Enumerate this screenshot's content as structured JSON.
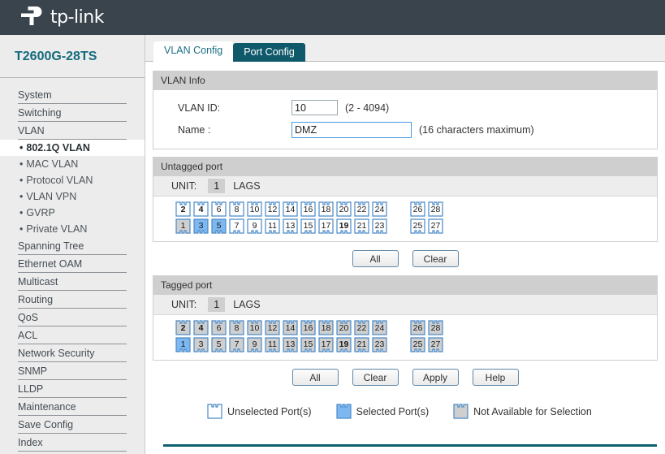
{
  "brand": {
    "name": "tp-link",
    "logo_icon": "tp-link-logo-icon"
  },
  "sidebar": {
    "model": "T2600G-28TS",
    "items": [
      {
        "label": "System",
        "type": "top"
      },
      {
        "label": "Switching",
        "type": "top"
      },
      {
        "label": "VLAN",
        "type": "top"
      },
      {
        "label": "802.1Q VLAN",
        "type": "sub",
        "active": true
      },
      {
        "label": "MAC VLAN",
        "type": "sub"
      },
      {
        "label": "Protocol VLAN",
        "type": "sub"
      },
      {
        "label": "VLAN VPN",
        "type": "sub"
      },
      {
        "label": "GVRP",
        "type": "sub"
      },
      {
        "label": "Private VLAN",
        "type": "sub"
      },
      {
        "label": "Spanning Tree",
        "type": "top"
      },
      {
        "label": "Ethernet OAM",
        "type": "top"
      },
      {
        "label": "Multicast",
        "type": "top"
      },
      {
        "label": "Routing",
        "type": "top"
      },
      {
        "label": "QoS",
        "type": "top"
      },
      {
        "label": "ACL",
        "type": "top"
      },
      {
        "label": "Network Security",
        "type": "top"
      },
      {
        "label": "SNMP",
        "type": "top"
      },
      {
        "label": "LLDP",
        "type": "top"
      },
      {
        "label": "Maintenance",
        "type": "top"
      },
      {
        "label": "Save Config",
        "type": "top"
      },
      {
        "label": "Index",
        "type": "top"
      }
    ],
    "bullet": "•"
  },
  "tabs": [
    {
      "label": "VLAN Config",
      "active": true
    },
    {
      "label": "Port Config",
      "active": false
    }
  ],
  "vlan_info": {
    "section_title": "VLAN Info",
    "vlan_id_label": "VLAN ID:",
    "vlan_id_value": "10",
    "vlan_id_hint": "(2 - 4094)",
    "name_label": "Name :",
    "name_value": "DMZ",
    "name_placeholder": "",
    "name_hint": "(16 characters maximum)"
  },
  "untagged": {
    "section_title": "Untagged port",
    "unit_label": "UNIT:",
    "unit_value": "1",
    "lags_label": "LAGS",
    "top_row": [
      {
        "n": "2",
        "state": "unselected",
        "bold": true
      },
      {
        "n": "4",
        "state": "unselected",
        "bold": true
      },
      {
        "n": "6",
        "state": "unselected",
        "bold": false
      },
      {
        "n": "8",
        "state": "unselected",
        "bold": false
      },
      {
        "n": "10",
        "state": "unselected",
        "bold": false
      },
      {
        "n": "12",
        "state": "unselected",
        "bold": false
      },
      {
        "n": "14",
        "state": "unselected",
        "bold": false
      },
      {
        "n": "16",
        "state": "unselected",
        "bold": false
      },
      {
        "n": "18",
        "state": "unselected",
        "bold": false
      },
      {
        "n": "20",
        "state": "unselected",
        "bold": false
      },
      {
        "n": "22",
        "state": "unselected",
        "bold": false
      },
      {
        "n": "24",
        "state": "unselected",
        "bold": false
      },
      {
        "gap": true
      },
      {
        "n": "26",
        "state": "unselected",
        "bold": false
      },
      {
        "n": "28",
        "state": "unselected",
        "bold": false
      }
    ],
    "bottom_row": [
      {
        "n": "1",
        "state": "unavailable",
        "bold": false
      },
      {
        "n": "3",
        "state": "selected",
        "bold": false
      },
      {
        "n": "5",
        "state": "selected",
        "bold": false
      },
      {
        "n": "7",
        "state": "unselected",
        "bold": false
      },
      {
        "n": "9",
        "state": "unselected",
        "bold": false
      },
      {
        "n": "11",
        "state": "unselected",
        "bold": false
      },
      {
        "n": "13",
        "state": "unselected",
        "bold": false
      },
      {
        "n": "15",
        "state": "unselected",
        "bold": false
      },
      {
        "n": "17",
        "state": "unselected",
        "bold": false
      },
      {
        "n": "19",
        "state": "unselected",
        "bold": true
      },
      {
        "n": "21",
        "state": "unselected",
        "bold": false
      },
      {
        "n": "23",
        "state": "unselected",
        "bold": false
      },
      {
        "gap": true
      },
      {
        "n": "25",
        "state": "unselected",
        "bold": false
      },
      {
        "n": "27",
        "state": "unselected",
        "bold": false
      }
    ],
    "buttons": [
      {
        "label": "All"
      },
      {
        "label": "Clear"
      }
    ]
  },
  "tagged": {
    "section_title": "Tagged port",
    "unit_label": "UNIT:",
    "unit_value": "1",
    "lags_label": "LAGS",
    "top_row": [
      {
        "n": "2",
        "state": "unavailable",
        "bold": true
      },
      {
        "n": "4",
        "state": "unavailable",
        "bold": true
      },
      {
        "n": "6",
        "state": "unavailable",
        "bold": false
      },
      {
        "n": "8",
        "state": "unavailable",
        "bold": false
      },
      {
        "n": "10",
        "state": "unavailable",
        "bold": false
      },
      {
        "n": "12",
        "state": "unavailable",
        "bold": false
      },
      {
        "n": "14",
        "state": "unavailable",
        "bold": false
      },
      {
        "n": "16",
        "state": "unavailable",
        "bold": false
      },
      {
        "n": "18",
        "state": "unavailable",
        "bold": false
      },
      {
        "n": "20",
        "state": "unavailable",
        "bold": false
      },
      {
        "n": "22",
        "state": "unavailable",
        "bold": false
      },
      {
        "n": "24",
        "state": "unavailable",
        "bold": false
      },
      {
        "gap": true
      },
      {
        "n": "26",
        "state": "unavailable",
        "bold": false
      },
      {
        "n": "28",
        "state": "unavailable",
        "bold": false
      }
    ],
    "bottom_row": [
      {
        "n": "1",
        "state": "selected",
        "bold": false
      },
      {
        "n": "3",
        "state": "unavailable",
        "bold": false
      },
      {
        "n": "5",
        "state": "unavailable",
        "bold": false
      },
      {
        "n": "7",
        "state": "unavailable",
        "bold": false
      },
      {
        "n": "9",
        "state": "unavailable",
        "bold": false
      },
      {
        "n": "11",
        "state": "unavailable",
        "bold": false
      },
      {
        "n": "13",
        "state": "unavailable",
        "bold": false
      },
      {
        "n": "15",
        "state": "unavailable",
        "bold": false
      },
      {
        "n": "17",
        "state": "unavailable",
        "bold": false
      },
      {
        "n": "19",
        "state": "unavailable",
        "bold": true
      },
      {
        "n": "21",
        "state": "unavailable",
        "bold": false
      },
      {
        "n": "23",
        "state": "unavailable",
        "bold": false
      },
      {
        "gap": true
      },
      {
        "n": "25",
        "state": "unavailable",
        "bold": false
      },
      {
        "n": "27",
        "state": "unavailable",
        "bold": false
      }
    ],
    "buttons": [
      {
        "label": "All"
      },
      {
        "label": "Clear"
      },
      {
        "label": "Apply"
      },
      {
        "label": "Help"
      }
    ]
  },
  "legend": [
    {
      "state": "unselected",
      "label": "Unselected Port(s)"
    },
    {
      "state": "selected",
      "label": "Selected Port(s)"
    },
    {
      "state": "unavailable",
      "label": "Not Available for Selection"
    }
  ],
  "colors": {
    "brand_bar": "#3a444d",
    "accent_teal": "#0d5f72",
    "model_text": "#146a7d",
    "port_selected": "#7db9f0",
    "port_unavailable": "#cfcfcf",
    "port_border": "#4a8ac7",
    "section_header": "#cfcfcf"
  }
}
